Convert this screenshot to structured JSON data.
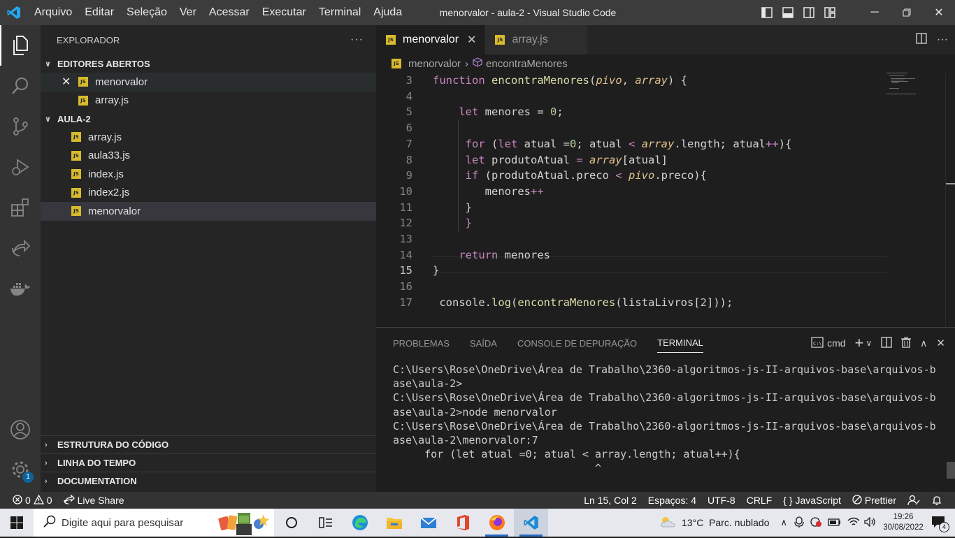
{
  "window": {
    "title": "menorvalor - aula-2 - Visual Studio Code",
    "menu": [
      "Arquivo",
      "Editar",
      "Seleção",
      "Ver",
      "Acessar",
      "Executar",
      "Terminal",
      "Ajuda"
    ]
  },
  "activity_bar": {
    "items": [
      "explorer-icon",
      "search-icon",
      "source-control-icon",
      "run-debug-icon",
      "extensions-icon",
      "live-share-icon",
      "docker-icon"
    ],
    "bottom": [
      "account-icon",
      "settings-gear-icon"
    ],
    "badge": "1"
  },
  "sidebar": {
    "title": "EXPLORADOR",
    "more": "···",
    "open_editors": {
      "header": "EDITORES ABERTOS",
      "files": [
        {
          "name": "menorvalor",
          "active": true
        },
        {
          "name": "array.js",
          "active": false
        }
      ]
    },
    "folder": {
      "header": "AULA-2",
      "files": [
        "array.js",
        "aula33.js",
        "index.js",
        "index2.js",
        "menorvalor"
      ],
      "selected": "menorvalor"
    },
    "bottom_sections": [
      "ESTRUTURA DO CÓDIGO",
      "LINHA DO TEMPO",
      "DOCUMENTATION"
    ]
  },
  "editor": {
    "tabs": [
      {
        "label": "menorvalor",
        "active": true
      },
      {
        "label": "array.js",
        "active": false
      }
    ],
    "breadcrumb": {
      "file": "menorvalor",
      "symbol": "encontraMenores"
    },
    "lines": [
      {
        "n": "3",
        "tokens": [
          [
            "kw",
            "function "
          ],
          [
            "fn",
            "encontraMenores"
          ],
          [
            "v",
            "("
          ],
          [
            "pr",
            "pivo"
          ],
          [
            "v",
            ", "
          ],
          [
            "pr",
            "array"
          ],
          [
            "v",
            ") {"
          ]
        ]
      },
      {
        "n": "4",
        "tokens": []
      },
      {
        "n": "5",
        "tokens": [
          [
            "v",
            "    "
          ],
          [
            "kw",
            "let "
          ],
          [
            "v",
            "menores "
          ],
          [
            "op",
            "= "
          ],
          [
            "num",
            "0"
          ],
          [
            "v",
            ";"
          ]
        ]
      },
      {
        "n": "6",
        "tokens": []
      },
      {
        "n": "7",
        "tokens": [
          [
            "v",
            "     "
          ],
          [
            "kw",
            "for "
          ],
          [
            "v",
            "("
          ],
          [
            "kw",
            "let "
          ],
          [
            "v",
            "atual "
          ],
          [
            "op",
            "="
          ],
          [
            "num",
            "0"
          ],
          [
            "v",
            "; atual "
          ],
          [
            "kw",
            "< "
          ],
          [
            "pr",
            "array"
          ],
          [
            "v",
            ".length; atual"
          ],
          [
            "kw",
            "++"
          ],
          [
            "v",
            "){"
          ]
        ]
      },
      {
        "n": "8",
        "tokens": [
          [
            "v",
            "     "
          ],
          [
            "kw",
            "let "
          ],
          [
            "v",
            "produtoAtual "
          ],
          [
            "kw",
            "= "
          ],
          [
            "pr",
            "array"
          ],
          [
            "v",
            "[atual]"
          ]
        ]
      },
      {
        "n": "9",
        "tokens": [
          [
            "v",
            "     "
          ],
          [
            "kw",
            "if "
          ],
          [
            "v",
            "(produtoAtual.preco "
          ],
          [
            "kw",
            "< "
          ],
          [
            "pr",
            "pivo"
          ],
          [
            "v",
            ".preco){"
          ]
        ]
      },
      {
        "n": "10",
        "tokens": [
          [
            "v",
            "        menores"
          ],
          [
            "kw",
            "++"
          ]
        ]
      },
      {
        "n": "11",
        "tokens": [
          [
            "v",
            "     }"
          ]
        ]
      },
      {
        "n": "12",
        "tokens": [
          [
            "v",
            "     "
          ],
          [
            "kw",
            "}"
          ]
        ]
      },
      {
        "n": "13",
        "tokens": []
      },
      {
        "n": "14",
        "tokens": [
          [
            "v",
            "    "
          ],
          [
            "kw",
            "return "
          ],
          [
            "v",
            "menores"
          ]
        ]
      },
      {
        "n": "15",
        "tokens": [
          [
            "v",
            "}"
          ]
        ]
      },
      {
        "n": "16",
        "tokens": []
      },
      {
        "n": "17",
        "tokens": [
          [
            "v",
            " console."
          ],
          [
            "fn",
            "log"
          ],
          [
            "v",
            "("
          ],
          [
            "fn",
            "encontraMenores"
          ],
          [
            "v",
            "(listaLivros["
          ],
          [
            "num",
            "2"
          ],
          [
            "v",
            "]));"
          ]
        ]
      }
    ],
    "current_line": "15"
  },
  "panel": {
    "tabs": [
      "PROBLEMAS",
      "SAÍDA",
      "CONSOLE DE DEPURAÇÃO",
      "TERMINAL"
    ],
    "active_tab": "TERMINAL",
    "shell": "cmd",
    "terminal_lines": [
      "C:\\Users\\Rose\\OneDrive\\Área de Trabalho\\2360-algoritmos-js-II-arquivos-base\\arquivos-b",
      "ase\\aula-2>",
      "C:\\Users\\Rose\\OneDrive\\Área de Trabalho\\2360-algoritmos-js-II-arquivos-base\\arquivos-b",
      "ase\\aula-2>node menorvalor",
      "C:\\Users\\Rose\\OneDrive\\Área de Trabalho\\2360-algoritmos-js-II-arquivos-base\\arquivos-b",
      "ase\\aula-2\\menorvalor:7",
      "     for (let atual =0; atual < array.length; atual++){",
      "                                ^"
    ]
  },
  "statusbar": {
    "errors": "0",
    "warnings": "0",
    "live_share": "Live Share",
    "position": "Ln 15, Col 2",
    "spaces": "Espaços: 4",
    "encoding": "UTF-8",
    "eol": "CRLF",
    "language": "JavaScript",
    "formatter": "Prettier"
  },
  "taskbar": {
    "search_placeholder": "Digite aqui para pesquisar",
    "weather": "13°C  Parc. nublado",
    "time": "19:26",
    "date": "30/08/2022",
    "notifications": "4"
  },
  "colors": {
    "accent": "#007acc",
    "js_badge": "#d7ba2d",
    "keyword": "#c586c0",
    "function": "#dcdcaa"
  }
}
